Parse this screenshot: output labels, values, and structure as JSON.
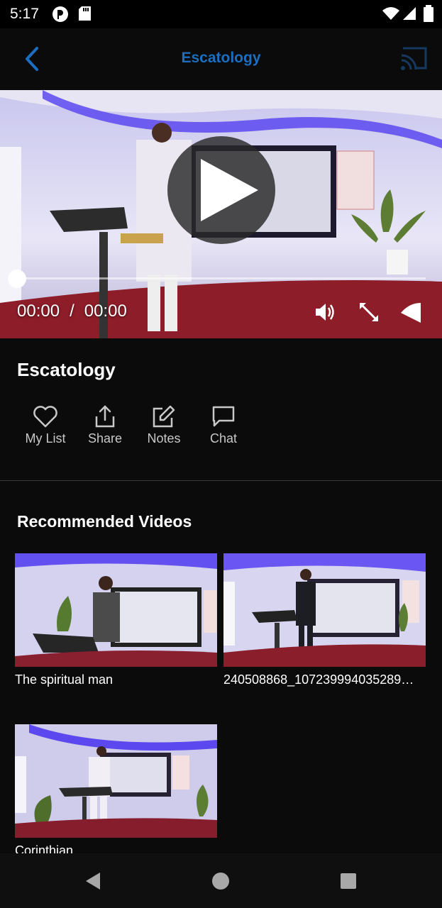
{
  "status": {
    "time": "5:17"
  },
  "header": {
    "title": "Escatology"
  },
  "player": {
    "current_time": "00:00",
    "separator": "/",
    "duration": "00:00",
    "progress": 0
  },
  "video": {
    "title": "Escatology"
  },
  "actions": [
    {
      "label": "My List",
      "icon": "heart-icon"
    },
    {
      "label": "Share",
      "icon": "share-icon"
    },
    {
      "label": "Notes",
      "icon": "edit-icon"
    },
    {
      "label": "Chat",
      "icon": "chat-icon"
    }
  ],
  "recommended": {
    "title": "Recommended Videos",
    "items": [
      {
        "label": "The spiritual man"
      },
      {
        "label": "240508868_107239994035289…"
      },
      {
        "label": "Corinthian"
      }
    ]
  },
  "colors": {
    "accent": "#1a6fc0",
    "background": "#0b0b0c"
  }
}
